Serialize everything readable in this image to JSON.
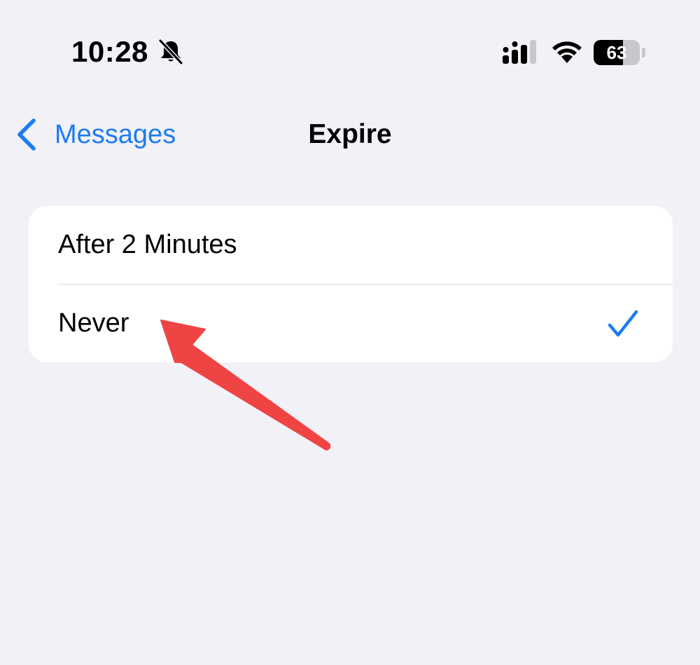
{
  "status_bar": {
    "time": "10:28",
    "battery_percent": "63",
    "battery_level": 0.63,
    "icons": [
      "bell-slash-icon",
      "cellular-signal-icon",
      "wifi-icon",
      "battery-icon"
    ]
  },
  "nav": {
    "back_label": "Messages",
    "title": "Expire"
  },
  "options": [
    {
      "label": "After 2 Minutes",
      "selected": false
    },
    {
      "label": "Never",
      "selected": true
    }
  ],
  "colors": {
    "accent": "#1c7cf3",
    "background": "#f2f1f7",
    "card": "#ffffff",
    "annotation_arrow": "#ef4444"
  }
}
